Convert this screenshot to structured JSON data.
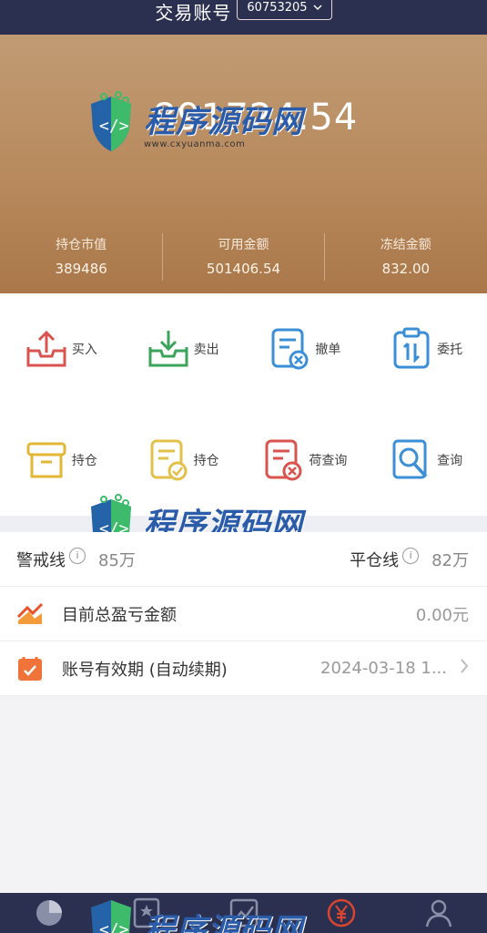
{
  "header": {
    "title": "交易账号",
    "account_id": "60753205"
  },
  "summary": {
    "total_assets": "891724.54",
    "stats": [
      {
        "label": "持仓市值",
        "value": "389486"
      },
      {
        "label": "可用金额",
        "value": "501406.54"
      },
      {
        "label": "冻结金额",
        "value": "832.00"
      }
    ]
  },
  "actions": [
    {
      "label": "买入",
      "icon": "buy-upload-icon",
      "color": "#d9534f"
    },
    {
      "label": "卖出",
      "icon": "sell-download-icon",
      "color": "#3aa55a"
    },
    {
      "label": "撤单",
      "icon": "cancel-order-icon",
      "color": "#3b8fd6"
    },
    {
      "label": "委托",
      "icon": "commission-icon",
      "color": "#3b8fd6"
    },
    {
      "label": "持仓",
      "icon": "holdings-box-icon",
      "color": "#e3b734"
    },
    {
      "label": "持仓",
      "icon": "holdings-doc-icon",
      "color": "#e3c04a"
    },
    {
      "label": "荷查询",
      "icon": "history-query-icon",
      "color": "#d9534f"
    },
    {
      "label": "查询",
      "icon": "search-query-icon",
      "color": "#3b8fd6"
    }
  ],
  "lines": {
    "warning": {
      "label": "警戒线",
      "value": "85万"
    },
    "liquidation": {
      "label": "平仓线",
      "value": "82万"
    }
  },
  "profit": {
    "label": "目前总盈亏金额",
    "value": "0.00元",
    "icon": "trend-chart-icon"
  },
  "validity": {
    "label": "账号有效期 (自动续期)",
    "value": "2024-03-18 1...",
    "icon": "calendar-check-icon"
  },
  "watermark": {
    "brand": "程序源码网",
    "url": "www.cxyuanma.com"
  },
  "nav": [
    "pie-chart-icon",
    "star-doc-icon",
    "trend-icon",
    "yuan-icon",
    "user-icon"
  ],
  "colors": {
    "header_bg": "#2c3050",
    "hero_start": "#c19b74",
    "hero_end": "#a9774a"
  }
}
